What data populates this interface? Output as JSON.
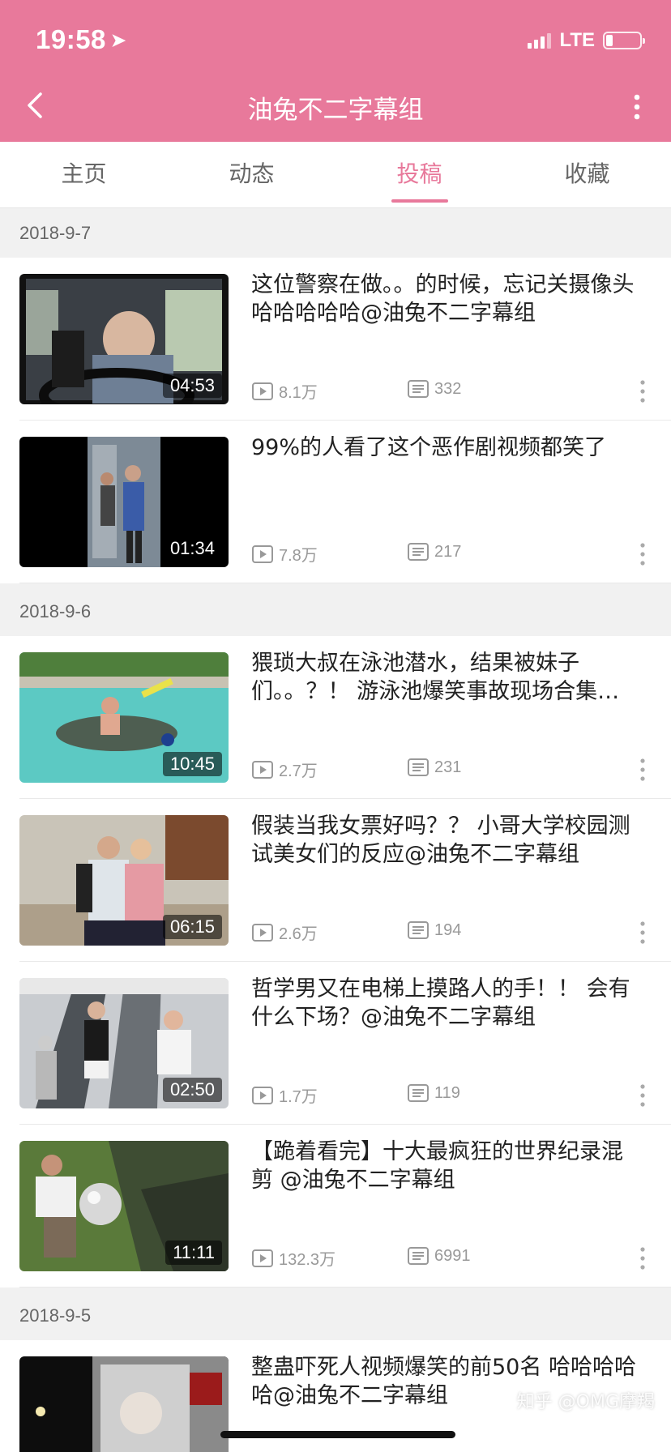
{
  "status_bar": {
    "time": "19:58",
    "network": "LTE",
    "battery_percent": 20
  },
  "nav": {
    "title": "油兔不二字幕组",
    "back_icon": "chevron-left-icon",
    "more_icon": "more-vertical-icon"
  },
  "tabs": [
    {
      "label": "主页",
      "active": false
    },
    {
      "label": "动态",
      "active": false
    },
    {
      "label": "投稿",
      "active": true
    },
    {
      "label": "收藏",
      "active": false
    }
  ],
  "accent_color": "#e8799b",
  "groups": [
    {
      "date": "2018-9-7",
      "items": [
        {
          "title": "这位警察在做。。的时候，忘记关摄像头  哈哈哈哈哈@油兔不二字幕组",
          "duration": "04:53",
          "plays": "8.1万",
          "comments": "332"
        },
        {
          "title": "99%的人看了这个恶作剧视频都笑了",
          "duration": "01:34",
          "plays": "7.8万",
          "comments": "217"
        }
      ]
    },
    {
      "date": "2018-9-6",
      "items": [
        {
          "title": "猥琐大叔在泳池潜水，结果被妹子们。。？！ 游泳池爆笑事故现场合集@油兔不二字幕组",
          "duration": "10:45",
          "plays": "2.7万",
          "comments": "231"
        },
        {
          "title": "假装当我女票好吗？？ 小哥大学校园测试美女们的反应@油兔不二字幕组",
          "duration": "06:15",
          "plays": "2.6万",
          "comments": "194"
        },
        {
          "title": "哲学男又在电梯上摸路人的手！！ 会有什么下场？@油兔不二字幕组",
          "duration": "02:50",
          "plays": "1.7万",
          "comments": "119"
        },
        {
          "title": "【跪着看完】十大最疯狂的世界纪录混剪  @油兔不二字幕组",
          "duration": "11:11",
          "plays": "132.3万",
          "comments": "6991"
        }
      ]
    },
    {
      "date": "2018-9-5",
      "items": [
        {
          "title": "整蛊吓死人视频爆笑的前50名  哈哈哈哈哈@油兔不二字幕组",
          "duration": "",
          "plays": "",
          "comments": ""
        }
      ]
    }
  ],
  "watermark": "知乎 @OMG摩羯"
}
